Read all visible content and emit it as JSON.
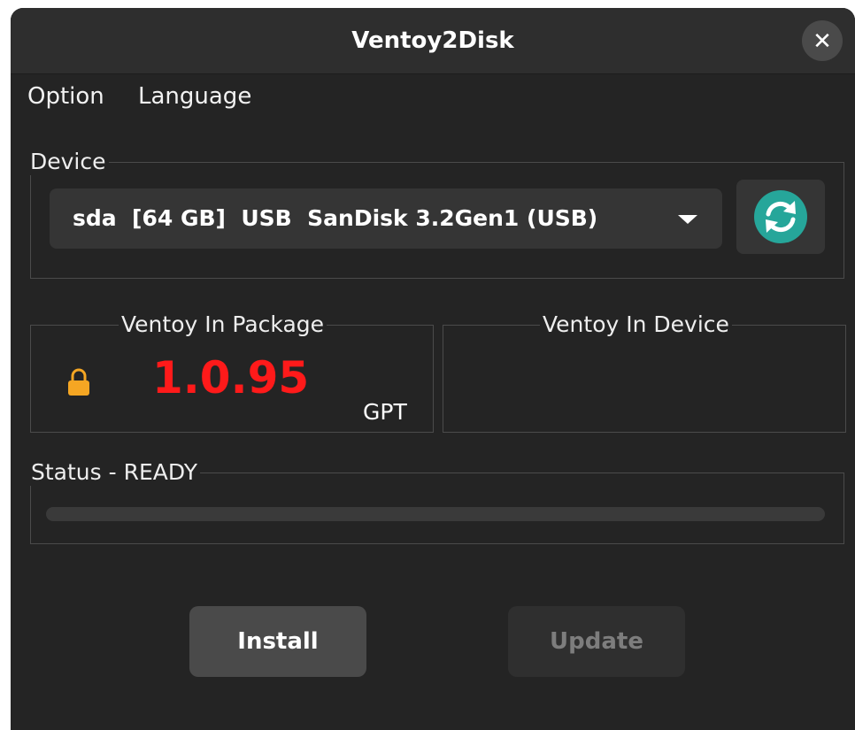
{
  "window": {
    "title": "Ventoy2Disk",
    "close_symbol": "✕"
  },
  "menu": {
    "items": [
      "Option",
      "Language"
    ]
  },
  "device": {
    "group_label": "Device",
    "selected": "sda  [64 GB]  USB  SanDisk 3.2Gen1 (USB)",
    "refresh_icon": "refresh-icon"
  },
  "package": {
    "group_label": "Ventoy In Package",
    "version": "1.0.95",
    "partition_style": "GPT",
    "lock_icon": "lock-icon",
    "version_color": "#ff1a1a"
  },
  "device_version": {
    "group_label": "Ventoy In Device",
    "version": ""
  },
  "status": {
    "group_label": "Status - READY",
    "progress": 0
  },
  "buttons": {
    "install": "Install",
    "update": "Update"
  },
  "colors": {
    "background": "#242424",
    "refresh_accent": "#26a69a",
    "lock_accent": "#f5a623"
  }
}
